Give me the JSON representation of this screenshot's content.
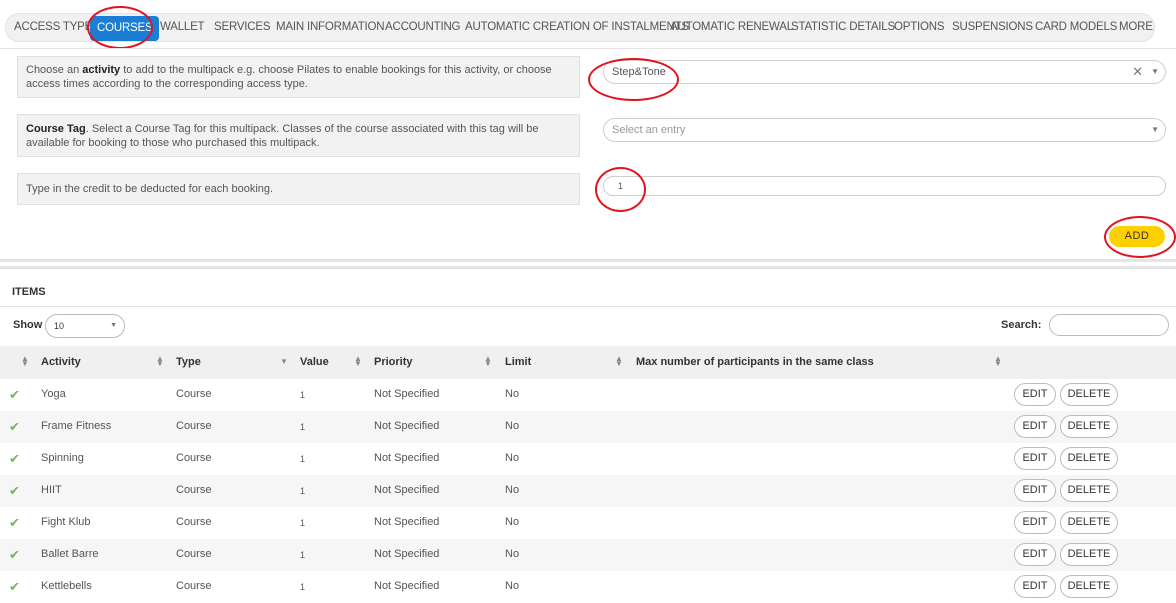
{
  "tabs": [
    {
      "label": "ACCESS TYPES"
    },
    {
      "label": "COURSES"
    },
    {
      "label": "WALLET"
    },
    {
      "label": "SERVICES"
    },
    {
      "label": "MAIN INFORMATION"
    },
    {
      "label": "ACCOUNTING"
    },
    {
      "label": "AUTOMATIC CREATION OF INSTALMENTS"
    },
    {
      "label": "AUTOMATIC RENEWAL"
    },
    {
      "label": "STATISTIC DETAILS"
    },
    {
      "label": "OPTIONS"
    },
    {
      "label": "SUSPENSIONS"
    },
    {
      "label": "CARD MODELS"
    },
    {
      "label": "MORE"
    }
  ],
  "active_tab": "COURSES",
  "form": {
    "activity": {
      "text_before": "Choose an ",
      "text_bold": "activity",
      "text_after": " to add to the multipack e.g. choose Pilates to enable bookings for this activity, or choose access times according to the corresponding access type.",
      "selected_value": "Step&Tone"
    },
    "course_tag": {
      "text_bold": "Course Tag",
      "text_after": ". Select a Course Tag for this multipack. Classes of the course associated with this tag will be available for booking to those who purchased this multipack.",
      "placeholder": "Select an entry"
    },
    "credit": {
      "text": "Type in the credit to be deducted for each booking.",
      "value": "1"
    },
    "add_label": "ADD"
  },
  "items": {
    "title": "ITEMS",
    "show_label": "Show",
    "show_value": "10",
    "search_label": "Search:",
    "columns": [
      "Activity",
      "Type",
      "Value",
      "Priority",
      "Limit",
      "Max number of participants in the same class"
    ],
    "rows": [
      {
        "activity": "Yoga",
        "type": "Course",
        "value": "1",
        "priority": "Not Specified",
        "limit": "No"
      },
      {
        "activity": "Frame Fitness",
        "type": "Course",
        "value": "1",
        "priority": "Not Specified",
        "limit": "No"
      },
      {
        "activity": "Spinning",
        "type": "Course",
        "value": "1",
        "priority": "Not Specified",
        "limit": "No"
      },
      {
        "activity": "HIIT",
        "type": "Course",
        "value": "1",
        "priority": "Not Specified",
        "limit": "No"
      },
      {
        "activity": "Fight Klub",
        "type": "Course",
        "value": "1",
        "priority": "Not Specified",
        "limit": "No"
      },
      {
        "activity": "Ballet Barre",
        "type": "Course",
        "value": "1",
        "priority": "Not Specified",
        "limit": "No"
      },
      {
        "activity": "Kettlebells",
        "type": "Course",
        "value": "1",
        "priority": "Not Specified",
        "limit": "No"
      }
    ],
    "edit_label": "EDIT",
    "delete_label": "DELETE"
  },
  "colors": {
    "active_tab": "#1a7fd4",
    "add_button": "#ffd000",
    "highlight_circle": "#e0141d",
    "check": "#6cc04a"
  },
  "icons": {
    "clear": "close-icon",
    "dropdown": "chevron-down-icon",
    "sort": "sort-icon",
    "row_status": "checkmark-icon"
  }
}
